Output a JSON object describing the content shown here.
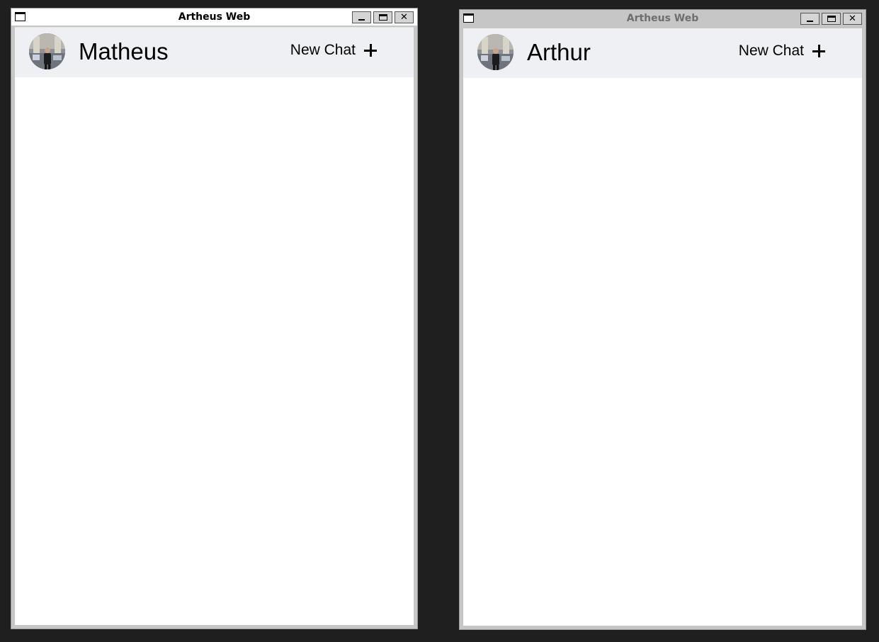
{
  "windows": [
    {
      "title": "Artheus Web",
      "state": "active",
      "buttons": {
        "minimize": "_",
        "maximize": "□",
        "close": "✕"
      },
      "header": {
        "username": "Matheus",
        "new_chat_label": "New Chat",
        "avatar_icon": "profile-photo"
      }
    },
    {
      "title": "Artheus Web",
      "state": "inactive",
      "buttons": {
        "minimize": "_",
        "maximize": "□",
        "close": "✕"
      },
      "header": {
        "username": "Arthur",
        "new_chat_label": "New Chat",
        "avatar_icon": "profile-photo"
      }
    }
  ],
  "colors": {
    "desktop": "#1f1f1f",
    "header_bg": "#eff0f3",
    "active_title_bg": "#ffffff",
    "inactive_title_bg": "#c6c6c6",
    "inactive_title_text": "#6e6e6e"
  }
}
